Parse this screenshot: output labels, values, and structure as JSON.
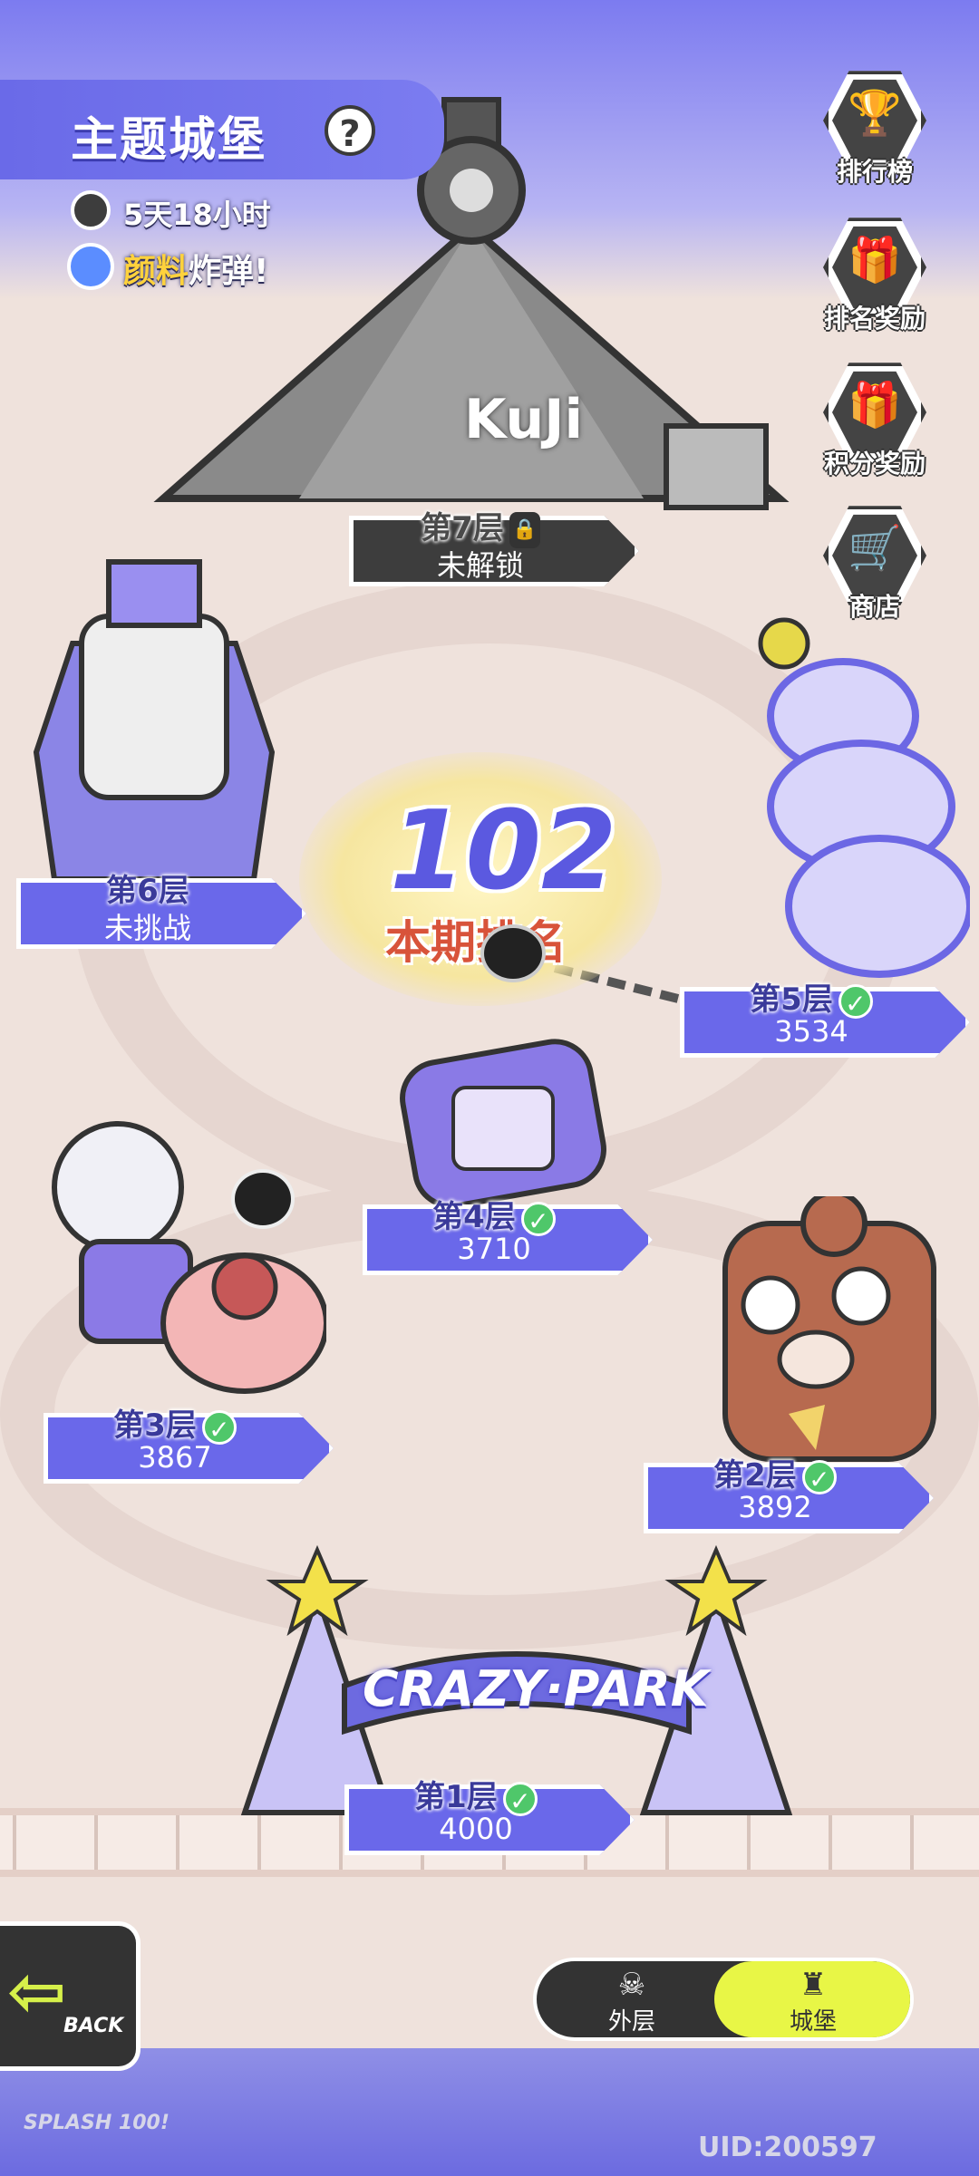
{
  "header": {
    "title": "主题城堡",
    "help_glyph": "?",
    "countdown": "5天18小时",
    "event_prefix": "颜料",
    "event_suffix": "炸弹!"
  },
  "side_buttons": [
    {
      "label": "排行榜",
      "icon": "trophy-icon"
    },
    {
      "label": "排名奖励",
      "icon": "rank-reward-icon"
    },
    {
      "label": "积分奖励",
      "icon": "points-reward-icon"
    },
    {
      "label": "商店",
      "icon": "shop-cart-icon"
    }
  ],
  "rank": {
    "value": "102",
    "label": "本期排名"
  },
  "floors": [
    {
      "name": "第7层",
      "status": "未解锁",
      "locked": true
    },
    {
      "name": "第6层",
      "status": "未挑战"
    },
    {
      "name": "第5层",
      "score": "3534",
      "done": true
    },
    {
      "name": "第4层",
      "score": "3710",
      "done": true
    },
    {
      "name": "第3层",
      "score": "3867",
      "done": true
    },
    {
      "name": "第2层",
      "score": "3892",
      "done": true
    },
    {
      "name": "第1层",
      "score": "4000",
      "done": true
    }
  ],
  "landmarks": {
    "tent_sign": "KuJi",
    "park_sign": "CRAZY·PARK"
  },
  "toggle": {
    "outer": "外层",
    "castle": "城堡"
  },
  "back_label": "BACK",
  "uid": "UID:200597",
  "logo": "SPLASH 100!",
  "colors": {
    "accent": "#6a68ea",
    "done": "#4fc76a",
    "toggle_active": "#e8f646",
    "rank": "#5b59e0"
  }
}
